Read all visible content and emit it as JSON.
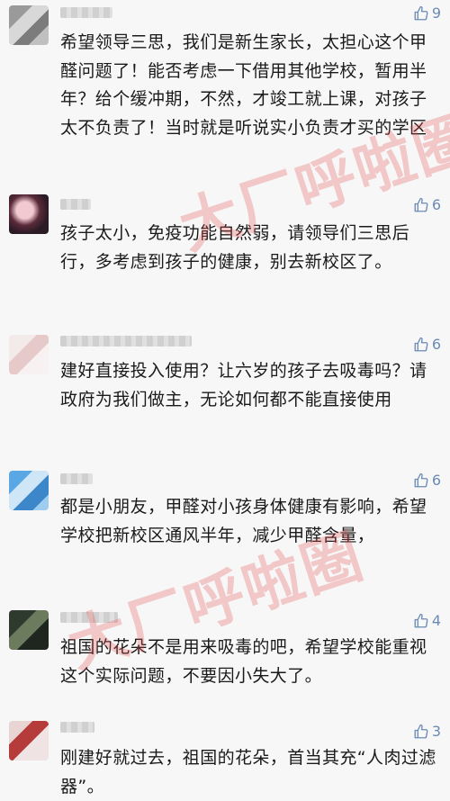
{
  "comments": [
    {
      "likes": "9",
      "text": "希望领导三思，我们是新生家长，太担心这个甲醛问题了！能否考虑一下借用其他学校，暂用半年？给个缓冲期，不然，才竣工就上课，对孩子太不负责了！当时就是听说实小负责才买的学区"
    },
    {
      "likes": "6",
      "text": "孩子太小，免疫功能自然弱，请领导们三思后行，多考虑到孩子的健康，别去新校区了。"
    },
    {
      "likes": "6",
      "text": "建好直接投入使用？让六岁的孩子去吸毒吗？请政府为我们做主，无论如何都不能直接使用"
    },
    {
      "likes": "6",
      "text": "都是小朋友，甲醛对小孩身体健康有影响，希望学校把新校区通风半年，减少甲醛含量，"
    },
    {
      "likes": "4",
      "text": "祖国的花朵不是用来吸毒的吧，希望学校能重视这个实际问题，不要因小失大了。"
    },
    {
      "likes": "3",
      "text": "刚建好就过去，祖国的花朵，首当其充“人肉过滤器”。"
    }
  ],
  "watermark": {
    "text": "大厂呼啦圈"
  },
  "colors": {
    "background": "#f7f7f7",
    "like": "#6b8bb5",
    "watermark": "#e74c4c"
  },
  "icons": {
    "like": "thumbs-up-icon"
  }
}
